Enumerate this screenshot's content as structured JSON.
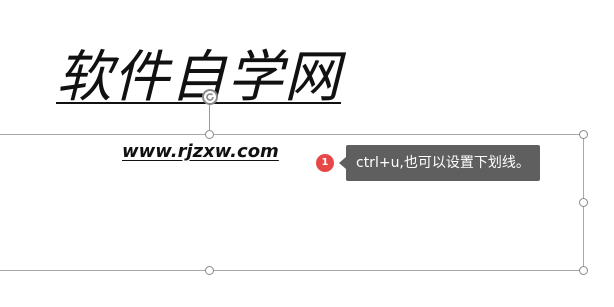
{
  "slide": {
    "title_text": "软件自学网",
    "url_text": "www.rjzxw.com"
  },
  "annotation": {
    "step_number": "1",
    "tooltip_text": "ctrl+u,也可以设置下划线。"
  },
  "icons": {
    "rotate": "rotate-handle-icon"
  },
  "colors": {
    "badge": "#e84747",
    "tooltip_bg": "#5f5f5f",
    "selection_border": "#a9a9a9"
  }
}
